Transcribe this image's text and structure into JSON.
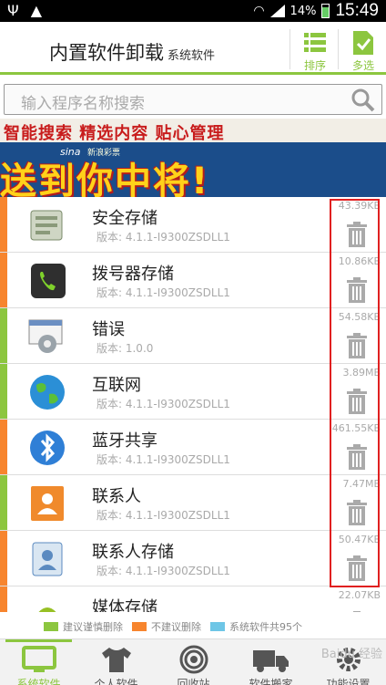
{
  "status": {
    "usb_icon": "usb-icon",
    "warning_icon": "warning-icon",
    "battery": "14%",
    "time": "15:49"
  },
  "header": {
    "title": "内置软件卸载",
    "subtitle": "系统软件",
    "sort_label": "排序",
    "multi_label": "多选",
    "accent": "#8cc63f"
  },
  "search": {
    "placeholder": "输入程序名称搜索"
  },
  "banner": {
    "strip": "智能搜索  精选内容  贴心管理",
    "headline": "送到你中将!",
    "brand": "sina",
    "brand_sub": "新浪彩票"
  },
  "apps": [
    {
      "name": "安全存储",
      "version": "版本: 4.1.1-I9300ZSDLL1",
      "size": "43.39KB",
      "color": "#f7852e",
      "icon": "secure-storage-icon"
    },
    {
      "name": "拨号器存储",
      "version": "版本: 4.1.1-I9300ZSDLL1",
      "size": "10.86KB",
      "color": "#f7852e",
      "icon": "dialer-icon"
    },
    {
      "name": "错误",
      "version": "版本: 1.0.0",
      "size": "54.58KB",
      "color": "#8cc63f",
      "icon": "error-report-icon"
    },
    {
      "name": "互联网",
      "version": "版本: 4.1.1-I9300ZSDLL1",
      "size": "3.89MB",
      "color": "#8cc63f",
      "icon": "globe-icon"
    },
    {
      "name": "蓝牙共享",
      "version": "版本: 4.1.1-I9300ZSDLL1",
      "size": "461.55KB",
      "color": "#f7852e",
      "icon": "bluetooth-icon"
    },
    {
      "name": "联系人",
      "version": "版本: 4.1.1-I9300ZSDLL1",
      "size": "7.47MB",
      "color": "#8cc63f",
      "icon": "contacts-icon"
    },
    {
      "name": "联系人存储",
      "version": "版本: 4.1.1-I9300ZSDLL1",
      "size": "50.47KB",
      "color": "#f7852e",
      "icon": "contacts-storage-icon"
    },
    {
      "name": "媒体存储",
      "version": "",
      "size": "22.07KB",
      "color": "#f7852e",
      "icon": "android-icon"
    }
  ],
  "legend": [
    {
      "label": "建议谨慎删除",
      "color": "#8cc63f"
    },
    {
      "label": "不建议删除",
      "color": "#f7852e"
    },
    {
      "label": "系统软件共95个",
      "color": "#6ec6e6"
    }
  ],
  "nav": [
    {
      "label": "系统软件",
      "icon": "monitor-icon",
      "active": true
    },
    {
      "label": "个人软件",
      "icon": "tshirt-icon",
      "active": false
    },
    {
      "label": "回收站",
      "icon": "target-icon",
      "active": false
    },
    {
      "label": "软件搬家",
      "icon": "truck-icon",
      "active": false
    },
    {
      "label": "功能设置",
      "icon": "gear-icon",
      "active": false
    }
  ],
  "watermark": "Baidu 经验"
}
